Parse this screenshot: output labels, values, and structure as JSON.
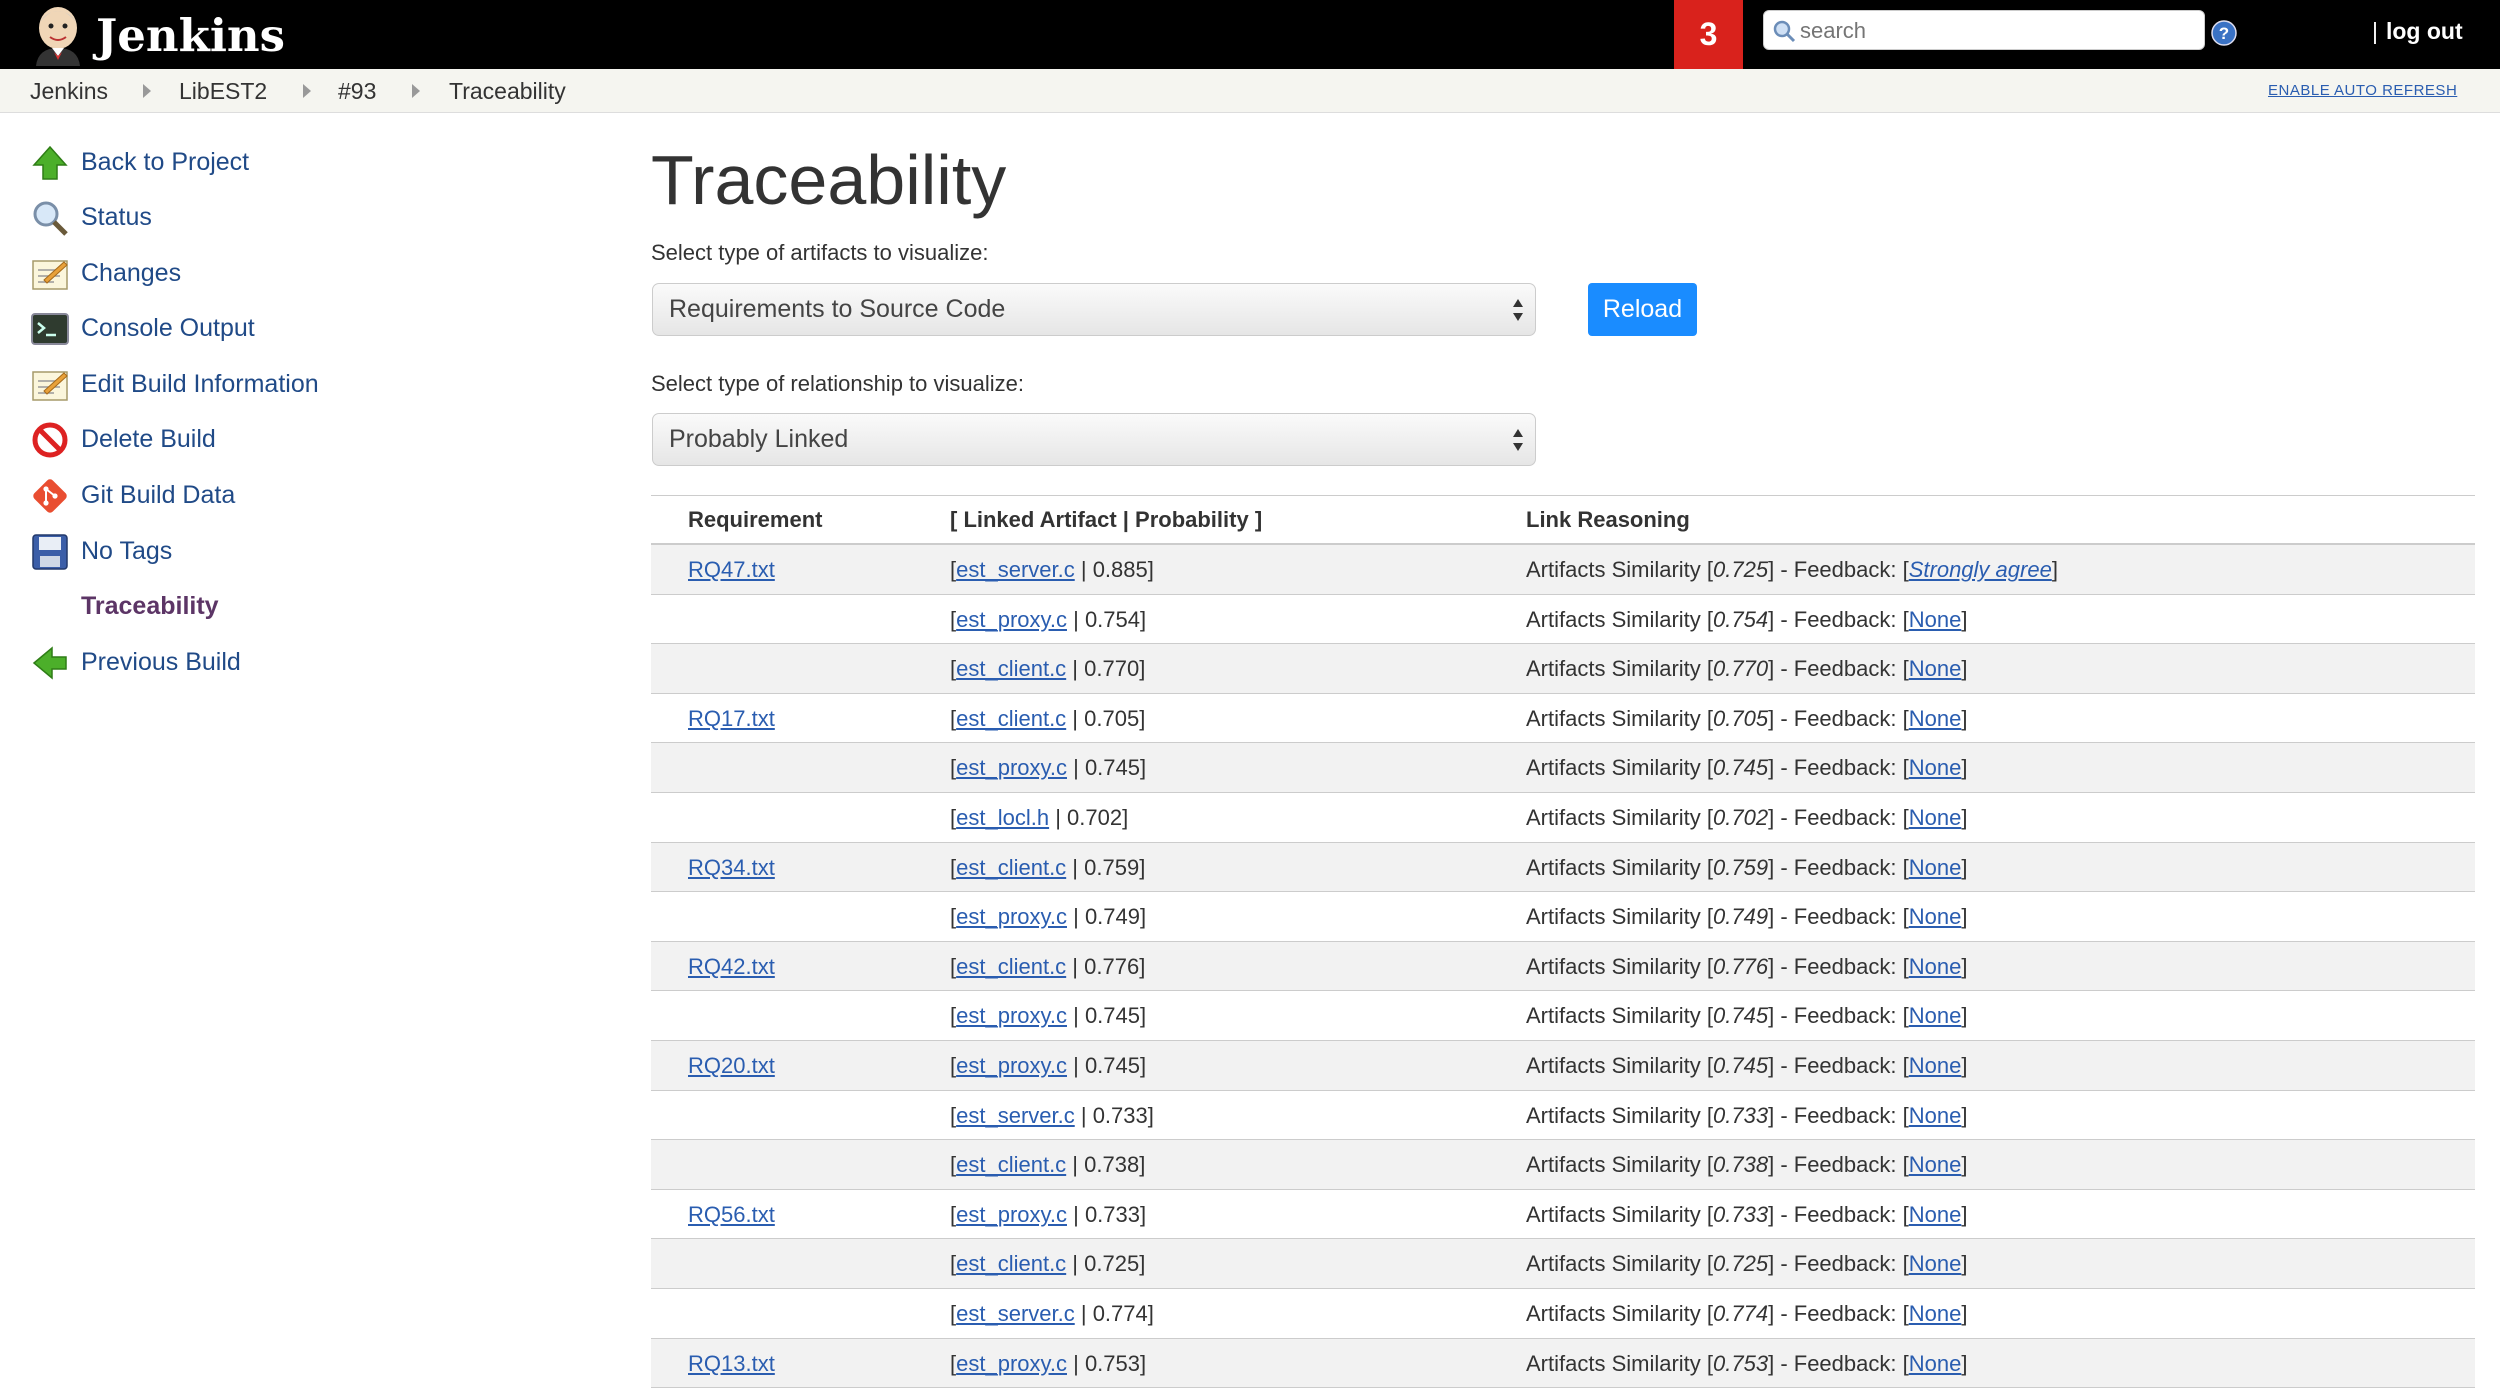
{
  "header": {
    "logo_text": "Jenkins",
    "notification_count": "3",
    "search_placeholder": "search",
    "logout_sep": "|",
    "logout_label": "log out"
  },
  "breadcrumb": {
    "items": [
      "Jenkins",
      "LibEST2",
      "#93",
      "Traceability"
    ],
    "auto_refresh": "ENABLE AUTO REFRESH"
  },
  "sidebar": {
    "items": [
      {
        "label": "Back to Project",
        "icon": "up-arrow-icon"
      },
      {
        "label": "Status",
        "icon": "magnifier-icon"
      },
      {
        "label": "Changes",
        "icon": "notepad-icon"
      },
      {
        "label": "Console Output",
        "icon": "terminal-icon"
      },
      {
        "label": "Edit Build Information",
        "icon": "notepad-icon"
      },
      {
        "label": "Delete Build",
        "icon": "no-entry-icon"
      },
      {
        "label": "Git Build Data",
        "icon": "git-icon"
      },
      {
        "label": "No Tags",
        "icon": "floppy-icon"
      },
      {
        "label": "Traceability",
        "icon": ""
      },
      {
        "label": "Previous Build",
        "icon": "left-arrow-icon"
      }
    ]
  },
  "main": {
    "title": "Traceability",
    "artifact_label": "Select type of artifacts to visualize:",
    "artifact_value": "Requirements to Source Code",
    "reload_label": "Reload",
    "relationship_label": "Select type of relationship to visualize:",
    "relationship_value": "Probably Linked"
  },
  "table": {
    "headers": [
      "Requirement",
      "[ Linked Artifact | Probability ]",
      "Link Reasoning"
    ],
    "reason_prefix": "Artifacts Similarity [",
    "reason_mid": "] - Feedback: [",
    "reason_suffix": "]",
    "rows": [
      {
        "req": "RQ47.txt",
        "artifact": "est_server.c",
        "prob": "0.885",
        "sim": "0.725",
        "feedback": "Strongly agree"
      },
      {
        "req": "",
        "artifact": "est_proxy.c",
        "prob": "0.754",
        "sim": "0.754",
        "feedback": "None"
      },
      {
        "req": "",
        "artifact": "est_client.c",
        "prob": "0.770",
        "sim": "0.770",
        "feedback": "None"
      },
      {
        "req": "RQ17.txt",
        "artifact": "est_client.c",
        "prob": "0.705",
        "sim": "0.705",
        "feedback": "None"
      },
      {
        "req": "",
        "artifact": "est_proxy.c",
        "prob": "0.745",
        "sim": "0.745",
        "feedback": "None"
      },
      {
        "req": "",
        "artifact": "est_locl.h",
        "prob": "0.702",
        "sim": "0.702",
        "feedback": "None"
      },
      {
        "req": "RQ34.txt",
        "artifact": "est_client.c",
        "prob": "0.759",
        "sim": "0.759",
        "feedback": "None"
      },
      {
        "req": "",
        "artifact": "est_proxy.c",
        "prob": "0.749",
        "sim": "0.749",
        "feedback": "None"
      },
      {
        "req": "RQ42.txt",
        "artifact": "est_client.c",
        "prob": "0.776",
        "sim": "0.776",
        "feedback": "None"
      },
      {
        "req": "",
        "artifact": "est_proxy.c",
        "prob": "0.745",
        "sim": "0.745",
        "feedback": "None"
      },
      {
        "req": "RQ20.txt",
        "artifact": "est_proxy.c",
        "prob": "0.745",
        "sim": "0.745",
        "feedback": "None"
      },
      {
        "req": "",
        "artifact": "est_server.c",
        "prob": "0.733",
        "sim": "0.733",
        "feedback": "None"
      },
      {
        "req": "",
        "artifact": "est_client.c",
        "prob": "0.738",
        "sim": "0.738",
        "feedback": "None"
      },
      {
        "req": "RQ56.txt",
        "artifact": "est_proxy.c",
        "prob": "0.733",
        "sim": "0.733",
        "feedback": "None"
      },
      {
        "req": "",
        "artifact": "est_client.c",
        "prob": "0.725",
        "sim": "0.725",
        "feedback": "None"
      },
      {
        "req": "",
        "artifact": "est_server.c",
        "prob": "0.774",
        "sim": "0.774",
        "feedback": "None"
      },
      {
        "req": "RQ13.txt",
        "artifact": "est_proxy.c",
        "prob": "0.753",
        "sim": "0.753",
        "feedback": "None"
      }
    ]
  }
}
